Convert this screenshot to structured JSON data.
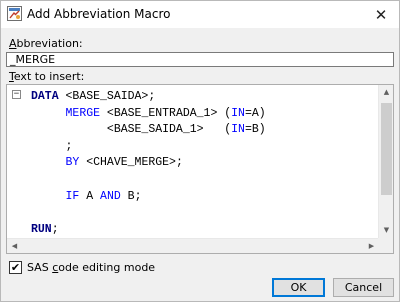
{
  "window": {
    "title": "Add Abbreviation Macro",
    "close_glyph": "✕"
  },
  "abbreviation": {
    "label_accel": "A",
    "label_rest": "bbreviation:",
    "value": "_MERGE"
  },
  "text_to_insert": {
    "label_accel": "T",
    "label_rest": "ext to insert:"
  },
  "editor": {
    "fold_glyph": "−",
    "lines": [
      [
        {
          "t": "DATA",
          "c": "kw"
        },
        {
          "t": " <BASE_SAIDA>;",
          "c": ""
        }
      ],
      [
        {
          "t": "     ",
          "c": ""
        },
        {
          "t": "MERGE",
          "c": "kb"
        },
        {
          "t": " <BASE_ENTRADA_1> (",
          "c": ""
        },
        {
          "t": "IN",
          "c": "kb"
        },
        {
          "t": "=A)",
          "c": ""
        }
      ],
      [
        {
          "t": "           <BASE_SAIDA_1>   (",
          "c": ""
        },
        {
          "t": "IN",
          "c": "kb"
        },
        {
          "t": "=B)",
          "c": ""
        }
      ],
      [
        {
          "t": "     ;",
          "c": ""
        }
      ],
      [
        {
          "t": "     ",
          "c": ""
        },
        {
          "t": "BY",
          "c": "kb"
        },
        {
          "t": " <CHAVE_MERGE>;",
          "c": ""
        }
      ],
      [
        {
          "t": "",
          "c": ""
        }
      ],
      [
        {
          "t": "     ",
          "c": ""
        },
        {
          "t": "IF",
          "c": "kb"
        },
        {
          "t": " A ",
          "c": ""
        },
        {
          "t": "AND",
          "c": "kb"
        },
        {
          "t": " B;",
          "c": ""
        }
      ],
      [
        {
          "t": "",
          "c": ""
        }
      ],
      [
        {
          "t": "RUN",
          "c": "kw"
        },
        {
          "t": ";",
          "c": ""
        }
      ]
    ]
  },
  "sas_mode": {
    "checked": true,
    "check_glyph": "✔",
    "label_pre": "SAS ",
    "label_accel": "c",
    "label_post": "ode editing mode"
  },
  "buttons": {
    "ok": "OK",
    "cancel": "Cancel"
  },
  "scroll_glyphs": {
    "up": "▲",
    "down": "▼",
    "left": "◀",
    "right": "▶"
  }
}
